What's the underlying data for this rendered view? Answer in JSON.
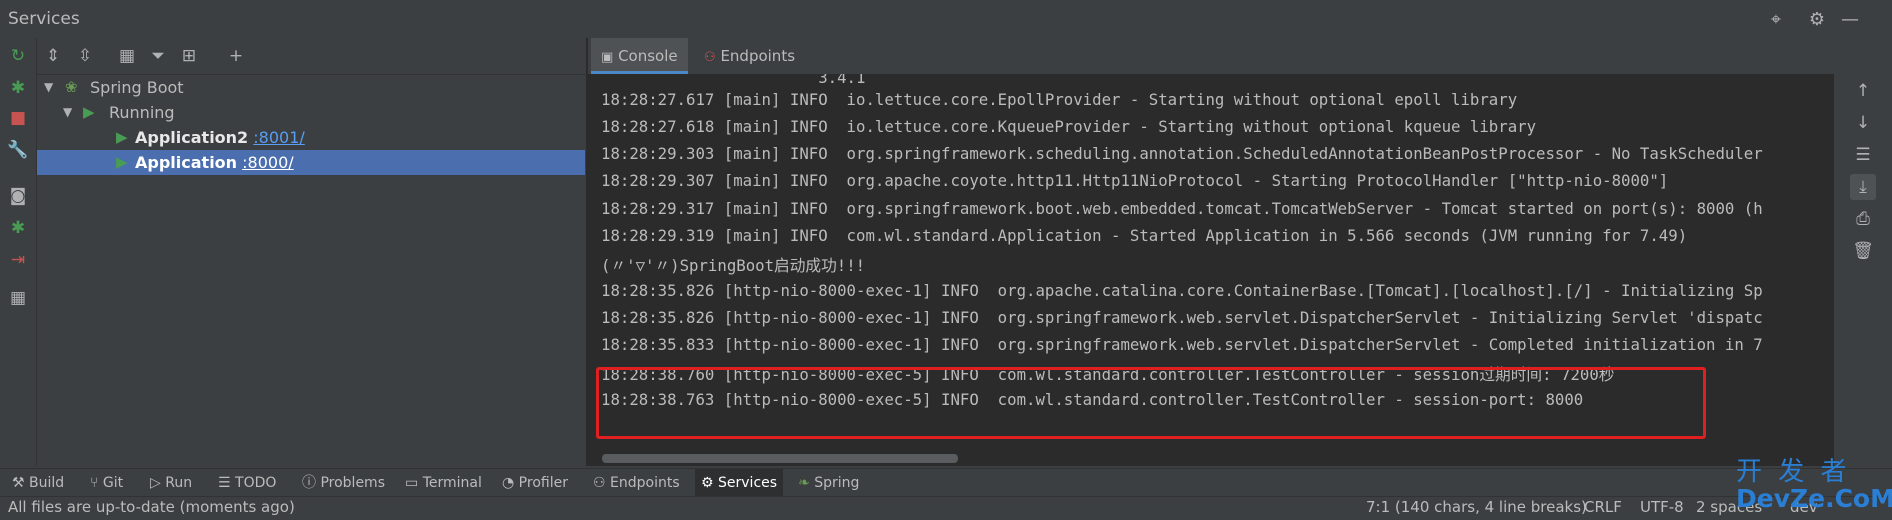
{
  "window": {
    "title": "Services"
  },
  "title_icons": [
    "crosshair-icon",
    "gear-icon",
    "minimize-icon"
  ],
  "tree": {
    "root": {
      "label": "Spring Boot"
    },
    "group": {
      "label": "Running"
    },
    "apps": [
      {
        "name": "Application2",
        "port": ":8001/"
      },
      {
        "name": "Application",
        "port": ":8000/"
      }
    ]
  },
  "console_tabs": [
    {
      "label": "Console",
      "active": true
    },
    {
      "label": "Endpoints",
      "active": false
    }
  ],
  "console": {
    "lines": [
      "                       3.4.1",
      "18:28:27.617 [main] INFO  io.lettuce.core.EpollProvider - Starting without optional epoll library",
      "18:28:27.618 [main] INFO  io.lettuce.core.KqueueProvider - Starting without optional kqueue library",
      "18:28:29.303 [main] INFO  org.springframework.scheduling.annotation.ScheduledAnnotationBeanPostProcessor - No TaskScheduler",
      "18:28:29.307 [main] INFO  org.apache.coyote.http11.Http11NioProtocol - Starting ProtocolHandler [\"http-nio-8000\"]",
      "18:28:29.317 [main] INFO  org.springframework.boot.web.embedded.tomcat.TomcatWebServer - Tomcat started on port(s): 8000 (h",
      "18:28:29.319 [main] INFO  com.wl.standard.Application - Started Application in 5.566 seconds (JVM running for 7.49)",
      "(〃'▽'〃)SpringBoot启动成功!!!",
      "18:28:35.826 [http-nio-8000-exec-1] INFO  org.apache.catalina.core.ContainerBase.[Tomcat].[localhost].[/] - Initializing Sp",
      "18:28:35.826 [http-nio-8000-exec-1] INFO  org.springframework.web.servlet.DispatcherServlet - Initializing Servlet 'dispatc",
      "18:28:35.833 [http-nio-8000-exec-1] INFO  org.springframework.web.servlet.DispatcherServlet - Completed initialization in 7",
      "18:28:38.760 [http-nio-8000-exec-5] INFO  com.wl.standard.controller.TestController - session过期时间: 7200秒",
      "18:28:38.763 [http-nio-8000-exec-5] INFO  com.wl.standard.controller.TestController - session-port: 8000"
    ]
  },
  "bottom_tabs": [
    {
      "label": "Build",
      "icon": "hammer-icon"
    },
    {
      "label": "Git",
      "icon": "git-branch-icon"
    },
    {
      "label": "Run",
      "icon": "run-icon"
    },
    {
      "label": "TODO",
      "icon": "list-icon"
    },
    {
      "label": "Problems",
      "icon": "info-icon"
    },
    {
      "label": "Terminal",
      "icon": "terminal-icon"
    },
    {
      "label": "Profiler",
      "icon": "profiler-icon"
    },
    {
      "label": "Endpoints",
      "icon": "endpoints-icon"
    },
    {
      "label": "Services",
      "icon": "services-icon",
      "active": true
    },
    {
      "label": "Spring",
      "icon": "spring-leaf-icon"
    }
  ],
  "status": {
    "message": "All files are up-to-date (moments ago)",
    "position": "7:1 (140 chars, 4 line breaks)",
    "line_sep": "CRLF",
    "encoding": "UTF-8",
    "indent": "2 spaces",
    "branch": "dev"
  },
  "watermark": {
    "line1": "开 发 者",
    "line2": "DevZe.CoM"
  },
  "colors": {
    "selection": "#4b6eaf",
    "console_bg": "#2b2b2b",
    "highlight_border": "#e02020",
    "link": "#589df6",
    "run_green": "#499c54"
  }
}
